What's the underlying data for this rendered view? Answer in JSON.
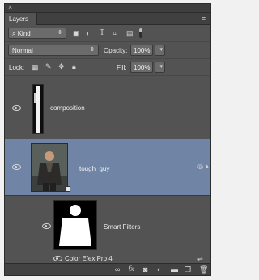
{
  "panel": {
    "tab_label": "Layers"
  },
  "filter": {
    "kind_label": "Kind"
  },
  "blend": {
    "mode_label": "Normal",
    "opacity_label": "Opacity:",
    "opacity_value": "100%"
  },
  "lock": {
    "label": "Lock:",
    "fill_label": "Fill:",
    "fill_value": "100%"
  },
  "layers": [
    {
      "name": "composition",
      "visible": true
    },
    {
      "name": "tough_guy",
      "visible": true,
      "selected": true
    },
    {
      "name": "Smart Filters",
      "visible": true
    },
    {
      "name": "Color Efex Pro 4",
      "visible": true
    }
  ],
  "bottom_icons": [
    "link-icon",
    "fx-icon",
    "mask-icon",
    "adjustment-icon",
    "folder-icon",
    "new-layer-icon",
    "trash-icon"
  ]
}
